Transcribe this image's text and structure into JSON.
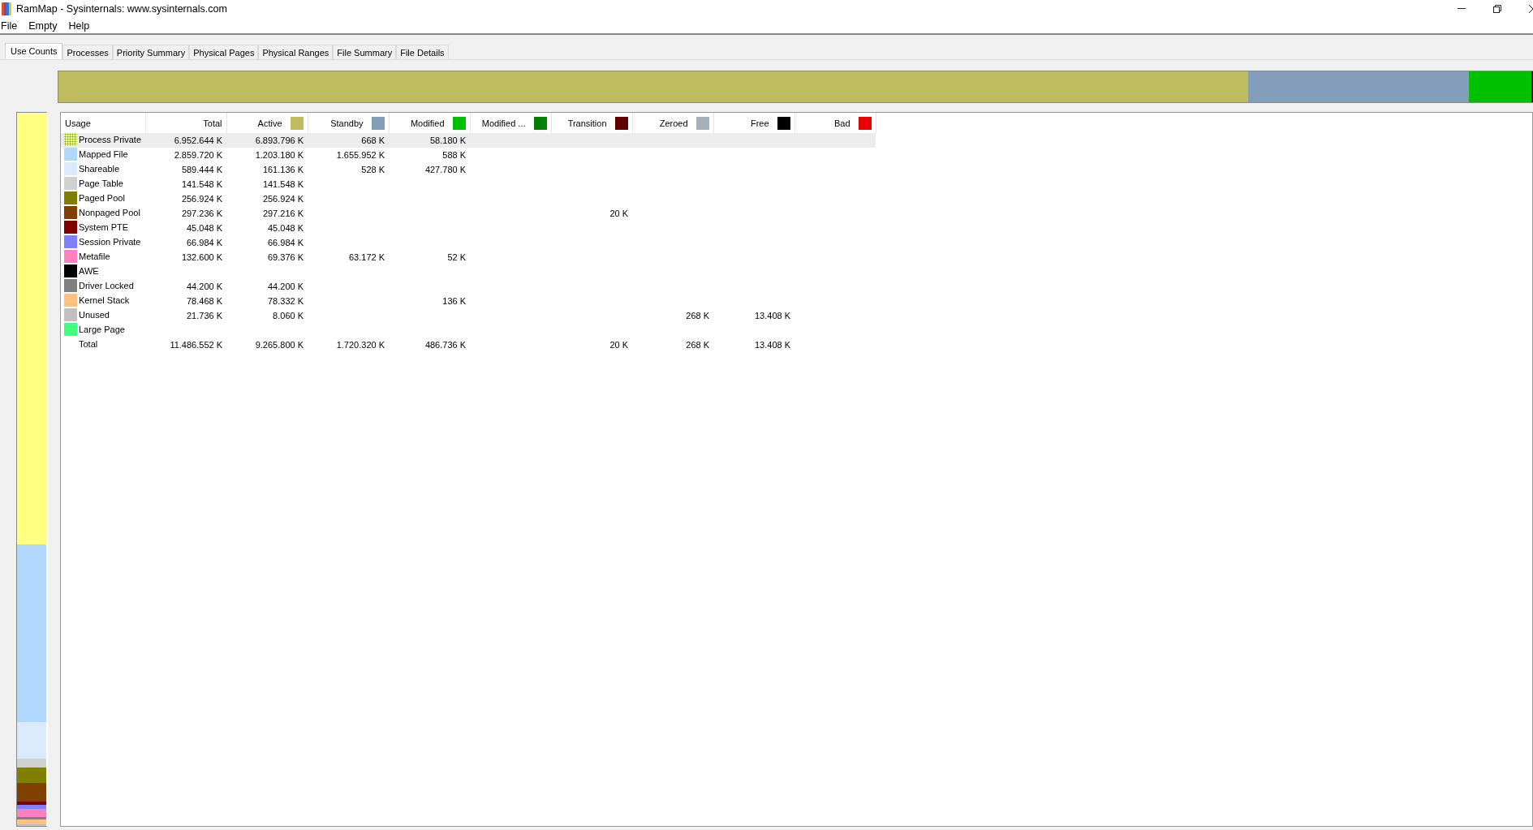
{
  "window": {
    "title": "RamMap - Sysinternals: www.sysinternals.com"
  },
  "menu": [
    "File",
    "Empty",
    "Help"
  ],
  "tabs": [
    {
      "label": "Use Counts",
      "selected": true
    },
    {
      "label": "Processes",
      "selected": false
    },
    {
      "label": "Priority Summary",
      "selected": false
    },
    {
      "label": "Physical Pages",
      "selected": false
    },
    {
      "label": "Physical Ranges",
      "selected": false
    },
    {
      "label": "File Summary",
      "selected": false
    },
    {
      "label": "File Details",
      "selected": false
    }
  ],
  "table": {
    "columns": [
      {
        "label": "Usage"
      },
      {
        "label": "Total"
      },
      {
        "label": "Active",
        "color": "#bfbd60"
      },
      {
        "label": "Standby",
        "color": "#849dbb"
      },
      {
        "label": "Modified",
        "color": "#00c000"
      },
      {
        "label": "Modified ...",
        "color": "#008000"
      },
      {
        "label": "Transition",
        "color": "#600000"
      },
      {
        "label": "Zeroed",
        "color": "#a6afba"
      },
      {
        "label": "Free",
        "color": "#000000"
      },
      {
        "label": "Bad",
        "color": "#e80000"
      }
    ],
    "rows": [
      {
        "usage": "Process Private",
        "color": "#ffff80",
        "selected": true,
        "total": "6.952.644 K",
        "active": "6.893.796 K",
        "standby": "668 K",
        "modified": "58.180 K"
      },
      {
        "usage": "Mapped File",
        "color": "#b0d8ff",
        "selected": false,
        "total": "2.859.720 K",
        "active": "1.203.180 K",
        "standby": "1.655.952 K",
        "modified": "588 K"
      },
      {
        "usage": "Shareable",
        "color": "#daeafc",
        "selected": false,
        "total": "589.444 K",
        "active": "161.136 K",
        "standby": "528 K",
        "modified": "427.780 K"
      },
      {
        "usage": "Page Table",
        "color": "#d0d0d0",
        "selected": false,
        "total": "141.548 K",
        "active": "141.548 K"
      },
      {
        "usage": "Paged Pool",
        "color": "#808000",
        "selected": false,
        "total": "256.924 K",
        "active": "256.924 K"
      },
      {
        "usage": "Nonpaged Pool",
        "color": "#804000",
        "selected": false,
        "total": "297.236 K",
        "active": "297.216 K",
        "transition": "20 K"
      },
      {
        "usage": "System PTE",
        "color": "#800000",
        "selected": false,
        "total": "45.048 K",
        "active": "45.048 K"
      },
      {
        "usage": "Session Private",
        "color": "#8080ff",
        "selected": false,
        "total": "66.984 K",
        "active": "66.984 K"
      },
      {
        "usage": "Metafile",
        "color": "#ff80c0",
        "selected": false,
        "total": "132.600 K",
        "active": "69.376 K",
        "standby": "63.172 K",
        "modified": "52 K"
      },
      {
        "usage": "AWE",
        "color": "#000000",
        "selected": false
      },
      {
        "usage": "Driver Locked",
        "color": "#808080",
        "selected": false,
        "total": "44.200 K",
        "active": "44.200 K"
      },
      {
        "usage": "Kernel Stack",
        "color": "#ffc080",
        "selected": false,
        "total": "78.468 K",
        "active": "78.332 K",
        "modified": "136 K"
      },
      {
        "usage": "Unused",
        "color": "#c0c0c0",
        "selected": false,
        "total": "21.736 K",
        "active": "8.060 K",
        "zeroed": "268 K",
        "free": "13.408 K"
      },
      {
        "usage": "Large Page",
        "color": "#40ff80",
        "selected": false
      }
    ],
    "total": {
      "usage": "Total",
      "total": "11.486.552 K",
      "active": "9.265.800 K",
      "standby": "1.720.320 K",
      "modified": "486.736 K",
      "transition": "20 K",
      "zeroed": "268 K",
      "free": "13.408 K"
    }
  }
}
